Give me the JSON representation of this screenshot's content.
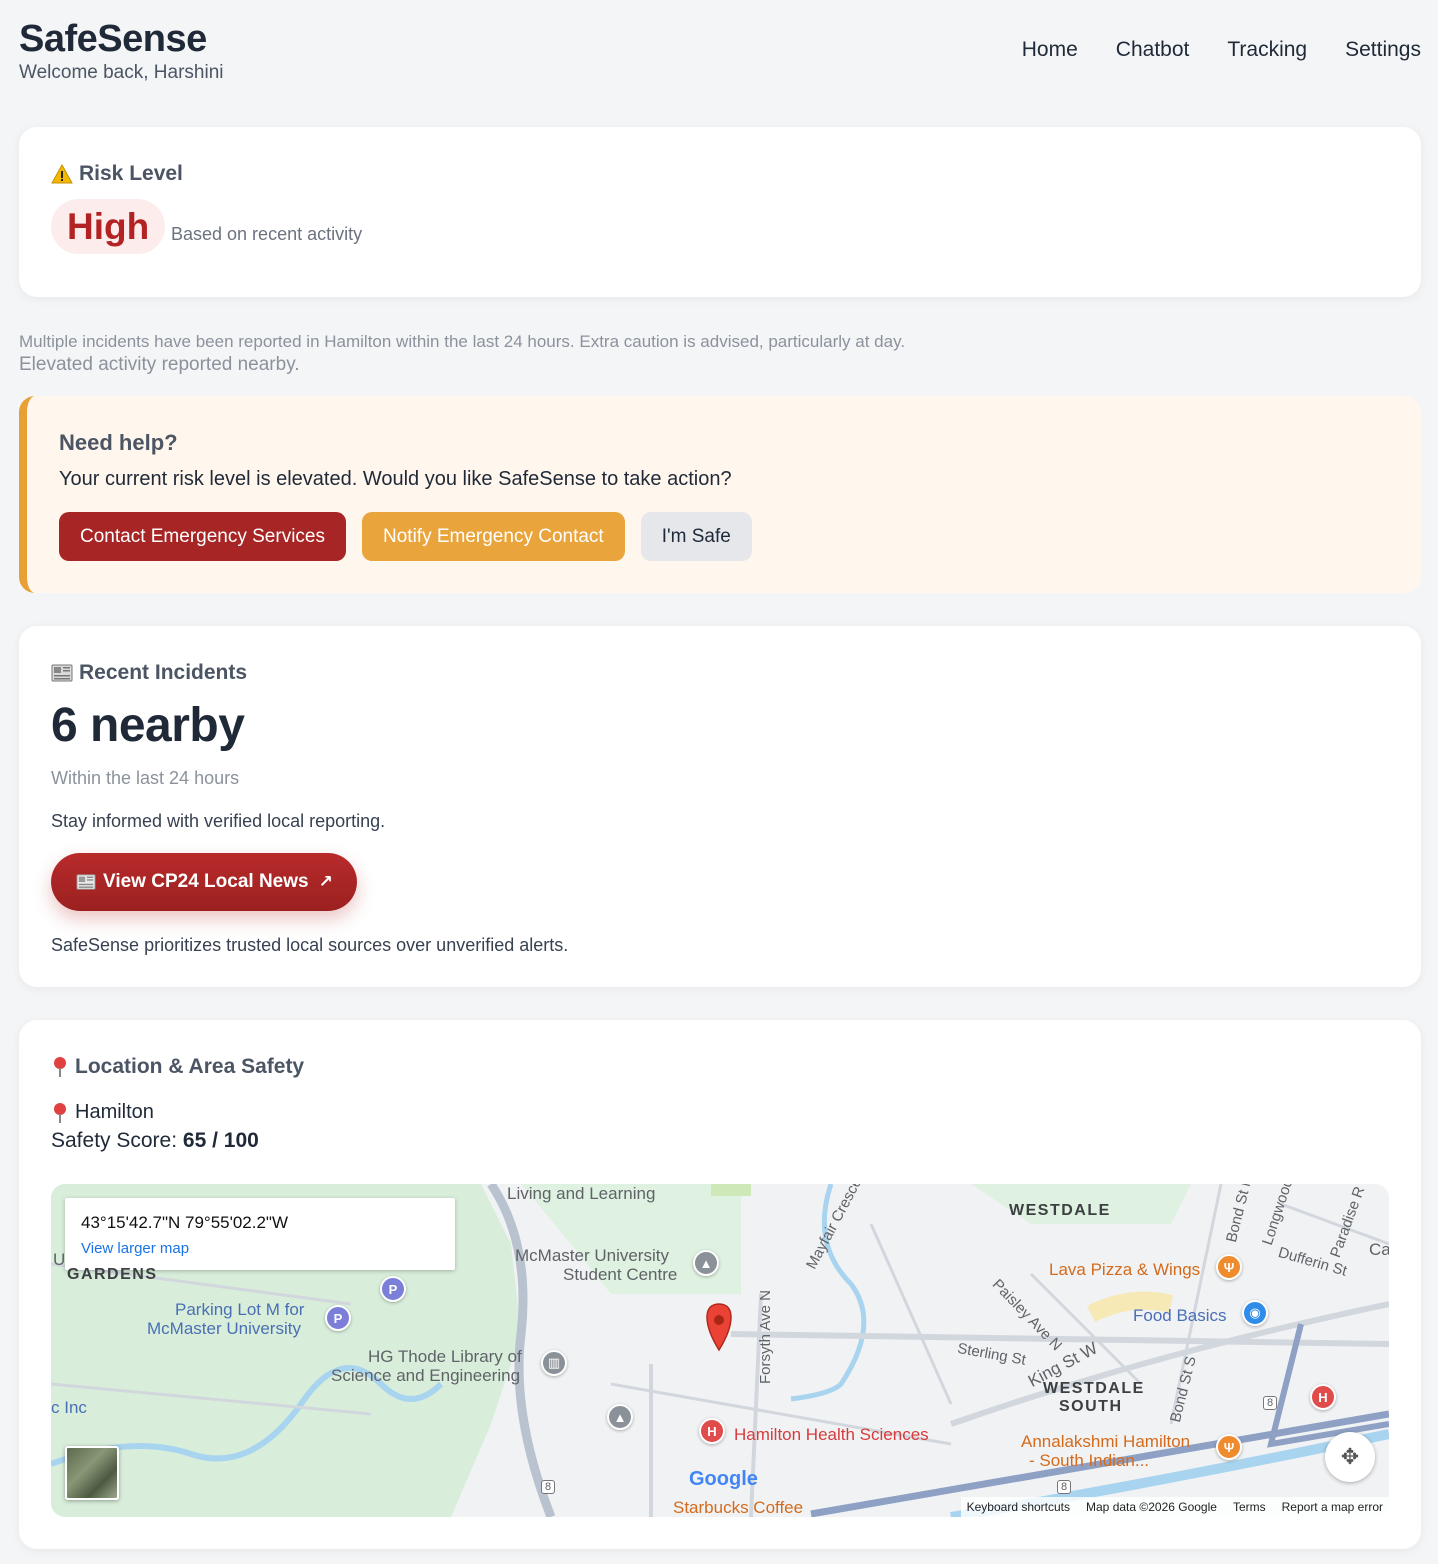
{
  "header": {
    "brand": "SafeSense",
    "welcome": "Welcome back, Harshini",
    "nav": [
      "Home",
      "Chatbot",
      "Tracking",
      "Settings"
    ]
  },
  "risk": {
    "title": "Risk Level",
    "level": "High",
    "subtitle": "Based on recent activity",
    "description": "Multiple incidents have been reported in Hamilton within the last 24 hours. Extra caution is advised, particularly at day.",
    "description2": "Elevated activity reported nearby.",
    "level_color": "#b42323"
  },
  "help": {
    "title": "Need help?",
    "text": "Your current risk level is elevated. Would you like SafeSense to take action?",
    "btn_emergency": "Contact Emergency Services",
    "btn_notify": "Notify Emergency Contact",
    "btn_safe": "I'm Safe",
    "accent": "#e8a035"
  },
  "incidents": {
    "title": "Recent Incidents",
    "count": "6 nearby",
    "window": "Within the last 24 hours",
    "info": "Stay informed with verified local reporting.",
    "news_btn": "View CP24 Local News",
    "footer": "SafeSense prioritizes trusted local sources over unverified alerts."
  },
  "location": {
    "title": "Location & Area Safety",
    "city": "Hamilton",
    "score_label": "Safety Score:",
    "score_value": "65 / 100"
  },
  "map": {
    "coords": "43°15'42.7\"N 79°55'02.2\"W",
    "view_larger": "View larger map",
    "labels": {
      "living": "Living and Learning",
      "mcmaster_sc1": "McMaster University",
      "mcmaster_sc2": "Student Centre",
      "parking1": "Parking Lot M for",
      "parking2": "McMaster University",
      "thode1": "HG Thode Library of",
      "thode2": "Science and Engineering",
      "gardens": "GARDENS",
      "westdale": "WESTDALE",
      "westdale_south1": "WESTDALE",
      "westdale_south2": "SOUTH",
      "lava": "Lava Pizza & Wings",
      "food_basics": "Food Basics",
      "hamilton_health": "Hamilton Health Sciences",
      "annalakshmi1": "Annalakshmi Hamilton",
      "annalakshmi2": "- South Indian...",
      "starbucks": "Starbucks Coffee",
      "inc": "c Inc",
      "u": "U",
      "ca": "Ca",
      "forsyth": "Forsyth Ave N",
      "mayfair": "Mayfair Crescent",
      "paisley": "Paisley Ave N",
      "sterling": "Sterling St",
      "king": "King St W",
      "bond_n": "Bond St N",
      "bond_s": "Bond St S",
      "longwood": "Longwood",
      "dufferin": "Dufferin St",
      "paradise": "Paradise R",
      "route8a": "8",
      "route8b": "8",
      "route8c": "8",
      "google": "Google"
    },
    "attribution": [
      "Keyboard shortcuts",
      "Map data ©2026 Google",
      "Terms",
      "Report a map error"
    ]
  }
}
